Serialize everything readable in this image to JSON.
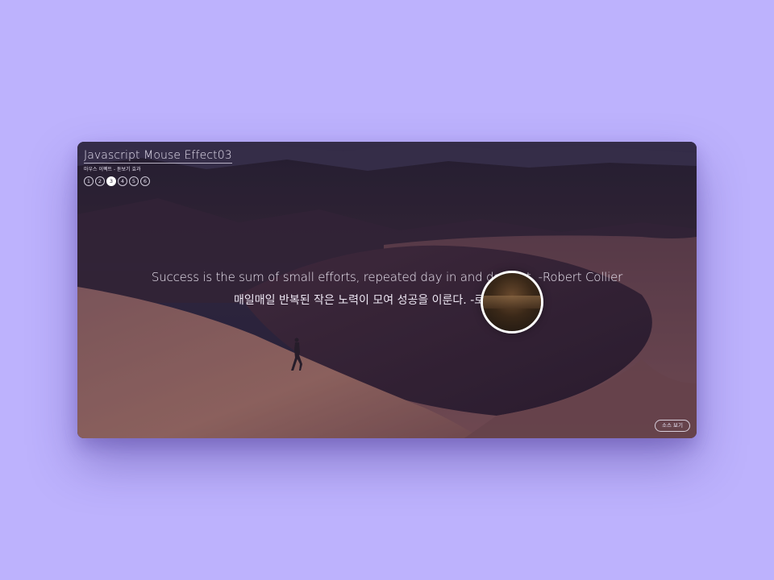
{
  "header": {
    "title": "Javascript Mouse Effect03",
    "subtitle": "마우스 이펙트 - 돋보기 효과"
  },
  "pager": {
    "pages": [
      "1",
      "2",
      "3",
      "4",
      "5",
      "6"
    ],
    "active_index": 2
  },
  "quote": {
    "english": "Success is the sum of small efforts, repeated day in and day out. -Robert Collier",
    "korean": "매일매일 반복된 작은 노력이 모여 성공을 이룬다. -로버트 콜리어"
  },
  "footer": {
    "source_button_label": "소스 보기"
  },
  "colors": {
    "page_background": "#bdb2fd",
    "text": "#ede7f3",
    "lens_border": "#ffffff"
  }
}
